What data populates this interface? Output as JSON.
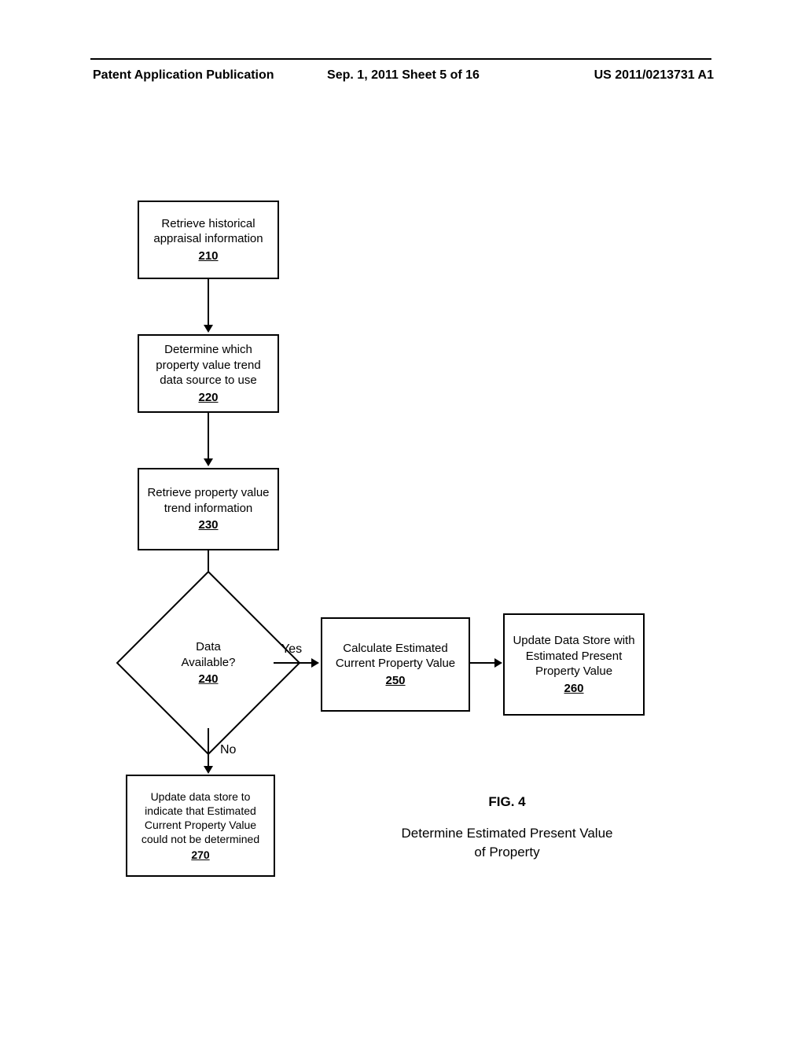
{
  "header": {
    "left": "Patent Application Publication",
    "center": "Sep. 1, 2011   Sheet 5 of 16",
    "right": "US 2011/0213731 A1"
  },
  "boxes": {
    "b210": {
      "text": "Retrieve historical appraisal information",
      "ref": "210"
    },
    "b220": {
      "text": "Determine which property value trend data source to use",
      "ref": "220"
    },
    "b230": {
      "text": "Retrieve property value trend information",
      "ref": "230"
    },
    "b240": {
      "text": "Data\nAvailable?",
      "ref": "240"
    },
    "b250": {
      "text": "Calculate Estimated Current Property Value",
      "ref": "250"
    },
    "b260": {
      "text": "Update Data Store with Estimated Present Property Value",
      "ref": "260"
    },
    "b270": {
      "text": "Update data store to indicate that Estimated Current Property Value could not be determined",
      "ref": "270"
    }
  },
  "labels": {
    "yes": "Yes",
    "no": "No"
  },
  "figure": {
    "number": "FIG. 4",
    "caption_line1": "Determine Estimated Present Value",
    "caption_line2": "of Property"
  }
}
